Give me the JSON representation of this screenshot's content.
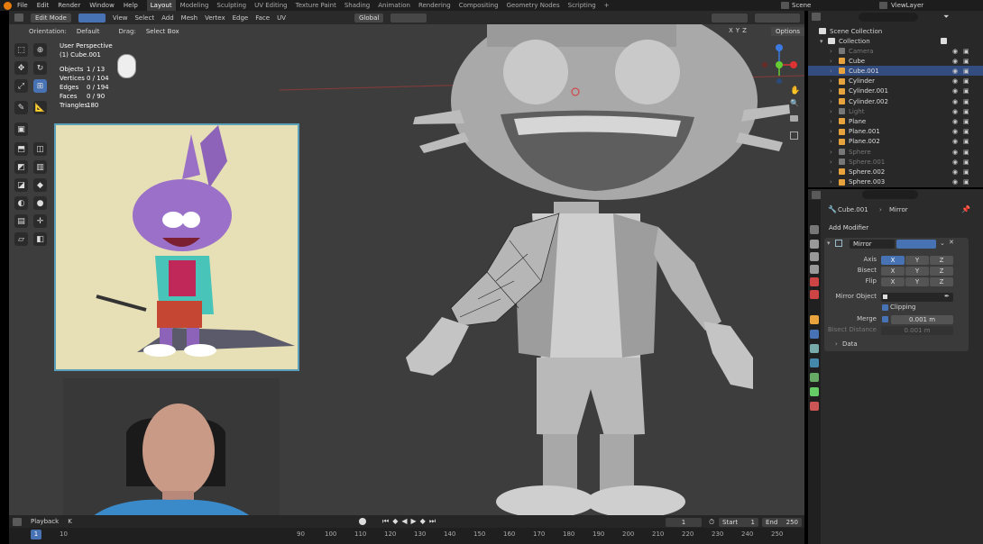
{
  "menu": {
    "items": [
      "File",
      "Edit",
      "Render",
      "Window",
      "Help"
    ],
    "workspaces": [
      "Layout",
      "Modeling",
      "Sculpting",
      "UV Editing",
      "Texture Paint",
      "Shading",
      "Animation",
      "Rendering",
      "Compositing",
      "Geometry Nodes",
      "Scripting"
    ],
    "active_workspace": "Layout",
    "add_tab": "+",
    "scene": "Scene",
    "view_layer": "ViewLayer"
  },
  "viewport_header": {
    "mode": "Edit Mode",
    "menus": [
      "View",
      "Select",
      "Add",
      "Mesh",
      "Vertex",
      "Edge",
      "Face",
      "UV"
    ],
    "transform_orientation": "Global",
    "orientation_label": "Orientation:",
    "orientation_value": "Default",
    "drag_label": "Drag:",
    "drag_value": "Select Box",
    "options": "Options",
    "xyz": [
      "X",
      "Y",
      "Z"
    ]
  },
  "viewport_info": {
    "perspective": "User Perspective",
    "object": "(1) Cube.001",
    "stats": [
      {
        "label": "Objects",
        "value": "1 / 13"
      },
      {
        "label": "Vertices",
        "value": "0 / 104"
      },
      {
        "label": "Edges",
        "value": "0 / 194"
      },
      {
        "label": "Faces",
        "value": "0 / 90"
      },
      {
        "label": "Triangles",
        "value": "180"
      }
    ]
  },
  "gizmo": {
    "x": "X",
    "y": "Y",
    "z": "Z"
  },
  "timeline": {
    "playback": "Playback",
    "keying": "K",
    "current_frame": "1",
    "start_label": "Start",
    "start": "1",
    "end_label": "End",
    "end": "250",
    "ruler": [
      "1",
      "10",
      "90",
      "100",
      "110",
      "120",
      "130",
      "140",
      "150",
      "160",
      "170",
      "180",
      "190",
      "200",
      "210",
      "220",
      "230",
      "240",
      "250"
    ]
  },
  "outliner": {
    "root": "Scene Collection",
    "collection": "Collection",
    "items": [
      {
        "name": "Camera",
        "dim": true
      },
      {
        "name": "Cube",
        "dim": false
      },
      {
        "name": "Cube.001",
        "dim": false,
        "selected": true
      },
      {
        "name": "Cylinder",
        "dim": false
      },
      {
        "name": "Cylinder.001",
        "dim": false
      },
      {
        "name": "Cylinder.002",
        "dim": false
      },
      {
        "name": "Light",
        "dim": true
      },
      {
        "name": "Plane",
        "dim": false
      },
      {
        "name": "Plane.001",
        "dim": false
      },
      {
        "name": "Plane.002",
        "dim": false
      },
      {
        "name": "Sphere",
        "dim": true
      },
      {
        "name": "Sphere.001",
        "dim": true
      },
      {
        "name": "Sphere.002",
        "dim": false
      },
      {
        "name": "Sphere.003",
        "dim": false
      }
    ]
  },
  "properties": {
    "breadcrumb_object": "Cube.001",
    "breadcrumb_modifier": "Mirror",
    "add_modifier": "Add Modifier",
    "modifier_name": "Mirror",
    "axis_label": "Axis",
    "bisect_label": "Bisect",
    "flip_label": "Flip",
    "axes": [
      "X",
      "Y",
      "Z"
    ],
    "mirror_object_label": "Mirror Object",
    "clipping_label": "Clipping",
    "merge_label": "Merge",
    "merge_value": "0.001 m",
    "bisect_distance_label": "Bisect Distance",
    "bisect_distance_value": "0.001 m",
    "data_label": "Data"
  },
  "colors": {
    "accent_blue": "#4772b3",
    "blender_orange": "#e87d0d",
    "viewport_bg": "#3d3d3d",
    "panel_bg": "#2b2b2b"
  }
}
